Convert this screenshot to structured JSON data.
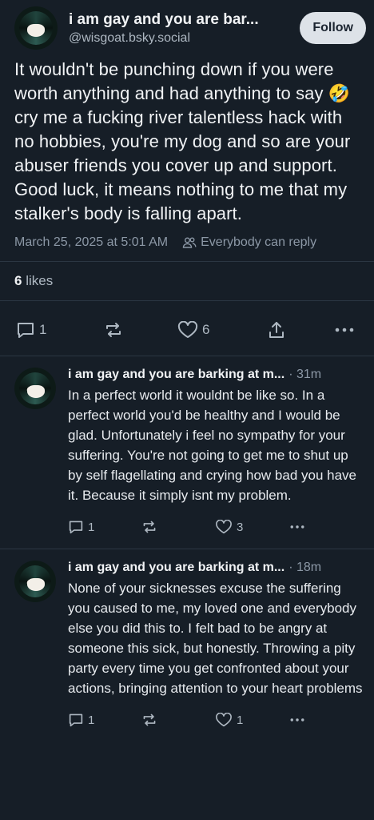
{
  "header": {
    "display_name": "i am gay and you are bar...",
    "handle": "@wisgoat.bsky.social",
    "follow_label": "Follow"
  },
  "post": {
    "text_part1": "It wouldn't be punching down if you were worth anything and had anything to say",
    "emoji": "🤣",
    "text_part2": "cry me a fucking river talentless hack with no hobbies, you're my dog and so are your abuser friends you cover up and support. Good luck, it means nothing to me that my stalker's body is falling apart.",
    "timestamp": "March 25, 2025 at 5:01 AM",
    "reply_setting": "Everybody can reply",
    "likes_count": "6",
    "likes_label": "likes",
    "reply_count": "1",
    "like_count": "6"
  },
  "replies": [
    {
      "display_name": "i am gay and you are barking at m...",
      "time": "· 31m",
      "text": "In a perfect world it wouldnt be like so. In a perfect world you'd be healthy and I would be glad. Unfortunately i feel no sympathy for your suffering. You're not going to get me to shut up by self flagellating and crying how bad you have it. Because it simply isnt my problem.",
      "reply_count": "1",
      "like_count": "3"
    },
    {
      "display_name": "i am gay and you are barking at m...",
      "time": "· 18m",
      "text": "None of your sicknesses excuse the suffering you caused to me, my loved one and everybody else you did this to. I felt bad to be angry at someone this sick, but honestly. Throwing a pity party every time you get confronted about your actions, bringing attention to your heart problems",
      "reply_count": "1",
      "like_count": "1"
    }
  ],
  "icons": {
    "reply": "comment-icon",
    "repost": "repost-icon",
    "like": "heart-icon",
    "share": "share-icon",
    "more": "more-icon",
    "audience": "people-icon"
  },
  "colors": {
    "background": "#161e27",
    "text": "#f1f3f5",
    "muted": "#8c98a6",
    "follow_bg": "#dde2e8"
  }
}
